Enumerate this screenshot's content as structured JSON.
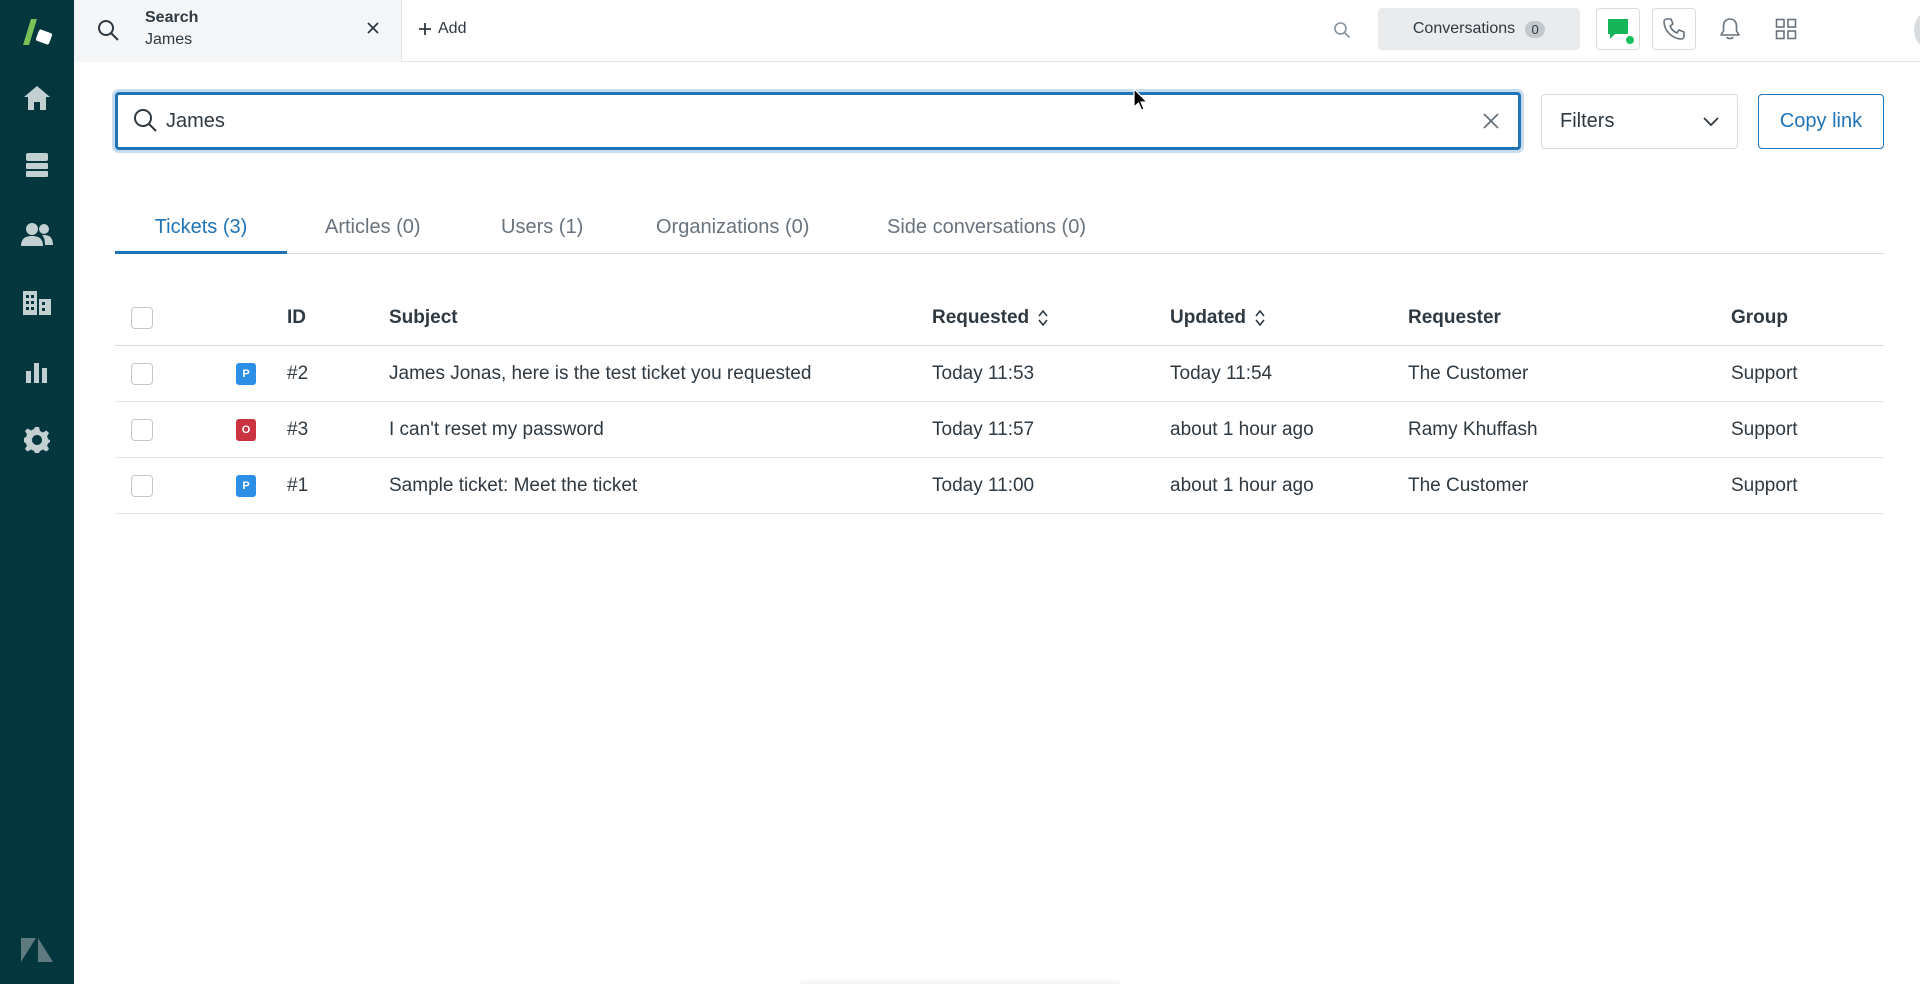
{
  "topbar": {
    "tab": {
      "title": "Search",
      "subtitle": "James"
    },
    "add_label": "Add",
    "conversations": {
      "label": "Conversations",
      "count": "0"
    }
  },
  "search": {
    "value": "James",
    "filters_label": "Filters",
    "copy_link_label": "Copy link"
  },
  "tabs": [
    {
      "label": "Tickets (3)",
      "active": true
    },
    {
      "label": "Articles (0)",
      "active": false
    },
    {
      "label": "Users (1)",
      "active": false
    },
    {
      "label": "Organizations (0)",
      "active": false
    },
    {
      "label": "Side conversations (0)",
      "active": false
    }
  ],
  "table": {
    "headers": {
      "id": "ID",
      "subject": "Subject",
      "requested": "Requested",
      "updated": "Updated",
      "requester": "Requester",
      "group": "Group"
    },
    "rows": [
      {
        "status": "P",
        "status_color": "#2d8ee6",
        "id": "#2",
        "subject": "James Jonas, here is the test ticket you requested",
        "requested": "Today 11:53",
        "updated": "Today 11:54",
        "requester": "The Customer",
        "group": "Support"
      },
      {
        "status": "O",
        "status_color": "#cc3340",
        "id": "#3",
        "subject": "I can't reset my password",
        "requested": "Today 11:57",
        "updated": "about 1 hour ago",
        "requester": "Ramy Khuffash",
        "group": "Support"
      },
      {
        "status": "P",
        "status_color": "#2d8ee6",
        "id": "#1",
        "subject": "Sample ticket: Meet the ticket",
        "requested": "Today 11:00",
        "updated": "about 1 hour ago",
        "requester": "The Customer",
        "group": "Support"
      }
    ]
  },
  "colors": {
    "sidebar": "#03363d",
    "accent": "#1f73b7",
    "online": "#17c05a",
    "chat": "#17b55a"
  }
}
